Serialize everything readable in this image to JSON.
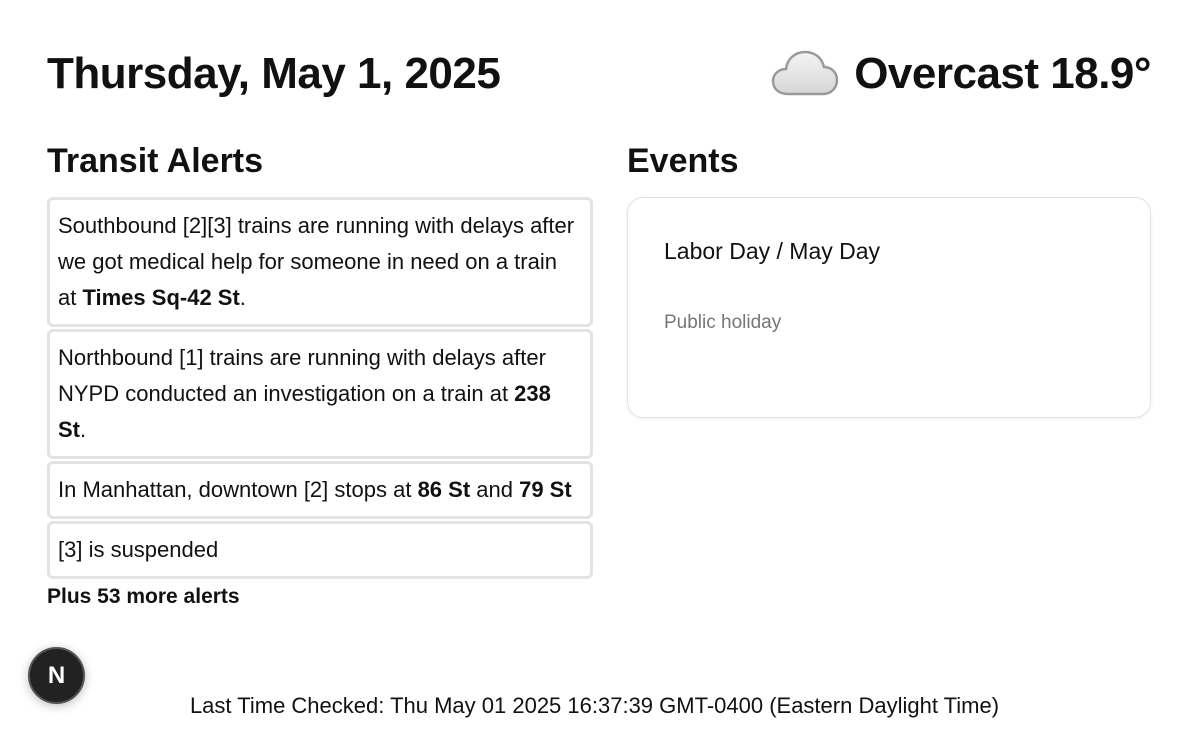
{
  "header": {
    "date": "Thursday, May 1, 2025",
    "weather": {
      "icon": "cloud-icon",
      "text": "Overcast 18.9°"
    }
  },
  "transit": {
    "title": "Transit Alerts",
    "alerts": [
      {
        "parts": [
          {
            "text": "Southbound [2][3] trains are running with delays after we got medical help for someone in need on a train at "
          },
          {
            "text": "Times Sq-42 St",
            "bold": true
          },
          {
            "text": "."
          }
        ]
      },
      {
        "parts": [
          {
            "text": "Northbound [1] trains are running with delays after NYPD conducted an investigation on a train at "
          },
          {
            "text": "238 St",
            "bold": true
          },
          {
            "text": "."
          }
        ]
      },
      {
        "parts": [
          {
            "text": "In Manhattan, downtown [2] stops at "
          },
          {
            "text": "86 St",
            "bold": true
          },
          {
            "text": " and "
          },
          {
            "text": "79 St",
            "bold": true
          }
        ]
      },
      {
        "parts": [
          {
            "text": "[3] is suspended"
          }
        ]
      }
    ],
    "more": "Plus 53 more alerts"
  },
  "events": {
    "title": "Events",
    "items": [
      {
        "name": "Labor Day / May Day",
        "type": "Public holiday"
      }
    ]
  },
  "footer": {
    "last_checked": "Last Time Checked: Thu May 01 2025 16:37:39 GMT-0400 (Eastern Daylight Time)"
  },
  "dev_badge": {
    "icon": "nextjs-logo-icon",
    "letter": "N"
  }
}
